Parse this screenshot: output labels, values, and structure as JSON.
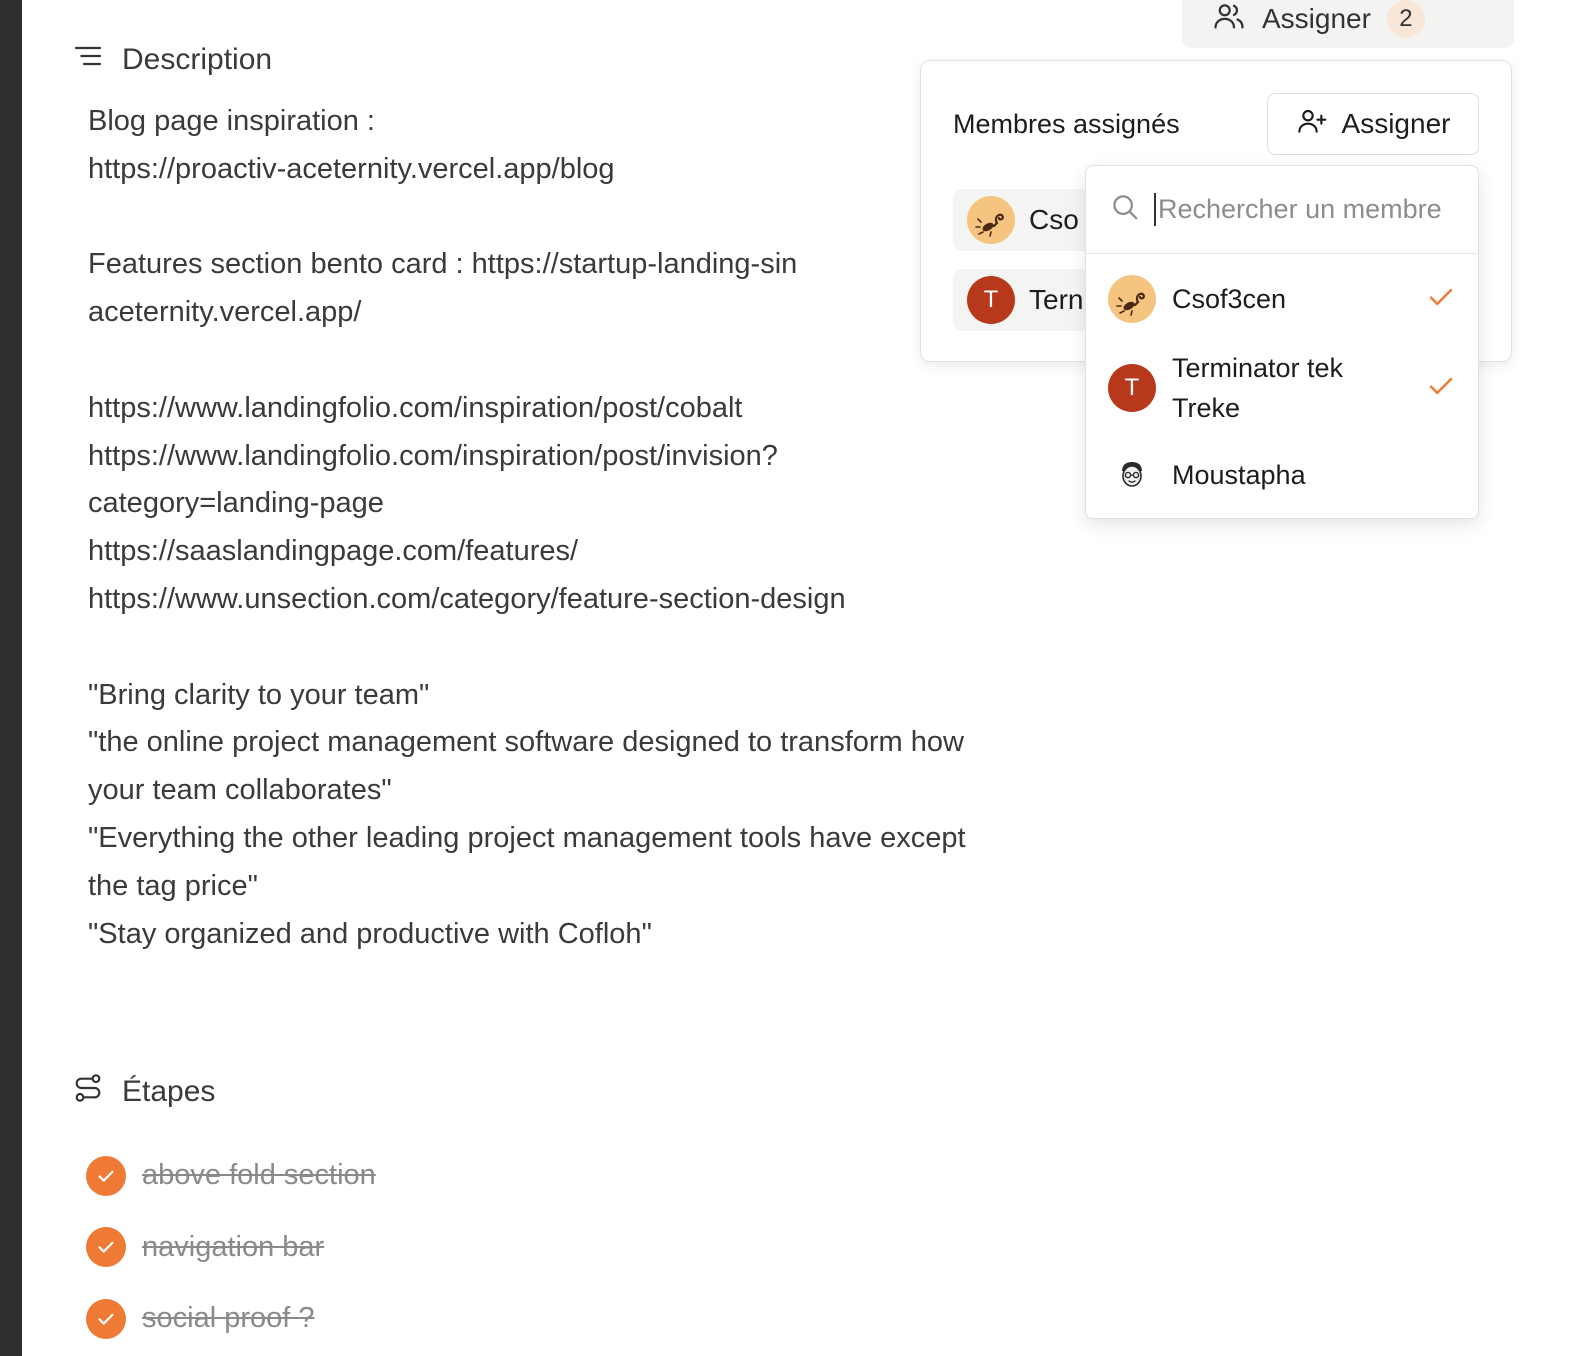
{
  "header": {
    "assign_label": "Assigner",
    "assign_count": "2"
  },
  "description": {
    "title": "Description",
    "lines": [
      "Blog page inspiration :",
      "https://proactiv-aceternity.vercel.app/blog",
      "",
      "Features section bento card : https://startup-landing-sin",
      "aceternity.vercel.app/",
      "",
      "https://www.landingfolio.com/inspiration/post/cobalt",
      "https://www.landingfolio.com/inspiration/post/invision?",
      "category=landing-page",
      "https://saaslandingpage.com/features/",
      "https://www.unsection.com/category/feature-section-design",
      "",
      "\"Bring clarity to your team\"",
      "\"the online project management software designed to transform how",
      "your team collaborates\"",
      "\"Everything the other leading project management tools have except",
      "the tag price\"",
      "\"Stay organized and productive with Cofloh\""
    ]
  },
  "steps": {
    "title": "Étapes",
    "items": [
      {
        "label": "above fold section",
        "done": true
      },
      {
        "label": "navigation bar",
        "done": true
      },
      {
        "label": "social proof ?",
        "done": true
      }
    ]
  },
  "assign_panel": {
    "title": "Membres assignés",
    "assign_button": "Assigner",
    "chips": [
      {
        "name": "Cso",
        "avatar": "scorpion-avatar"
      },
      {
        "name": "Tern",
        "avatar": "T"
      }
    ]
  },
  "member_dropdown": {
    "search_placeholder": "Rechercher un membre",
    "members": [
      {
        "name": "Csof3cen",
        "avatar": "scorpion-avatar",
        "selected": true
      },
      {
        "name": "Terminator tek Treke",
        "avatar": "T",
        "selected": true
      },
      {
        "name": "Moustapha",
        "avatar": "face-avatar",
        "selected": false
      }
    ]
  },
  "colors": {
    "accent": "#ee7a35",
    "avatar_red": "#b7381b",
    "badge_bg": "#f8e6d8"
  }
}
